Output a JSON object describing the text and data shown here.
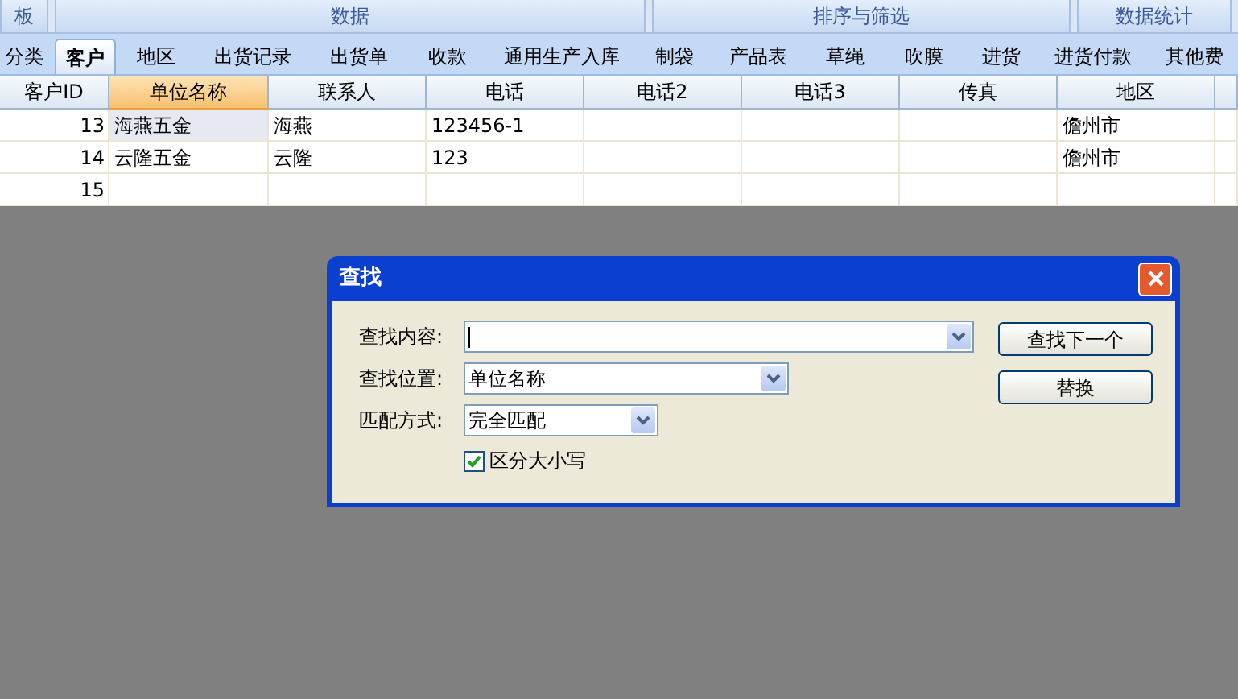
{
  "ribbon_groups": [
    {
      "label": "板"
    },
    {
      "label": "数据"
    },
    {
      "label": "排序与筛选"
    },
    {
      "label": "数据统计"
    }
  ],
  "tabs": [
    {
      "label": "分类",
      "selected": false
    },
    {
      "label": "客户",
      "selected": true
    },
    {
      "label": "地区",
      "selected": false
    },
    {
      "label": "出货记录",
      "selected": false
    },
    {
      "label": "出货单",
      "selected": false
    },
    {
      "label": "收款",
      "selected": false
    },
    {
      "label": "通用生产入库",
      "selected": false
    },
    {
      "label": "制袋",
      "selected": false
    },
    {
      "label": "产品表",
      "selected": false
    },
    {
      "label": "草绳",
      "selected": false
    },
    {
      "label": "吹膜",
      "selected": false
    },
    {
      "label": "进货",
      "selected": false
    },
    {
      "label": "进货付款",
      "selected": false
    },
    {
      "label": "其他费",
      "selected": false
    }
  ],
  "table": {
    "columns": [
      {
        "label": "客户ID",
        "selected": false
      },
      {
        "label": "单位名称",
        "selected": true
      },
      {
        "label": "联系人",
        "selected": false
      },
      {
        "label": "电话",
        "selected": false
      },
      {
        "label": "电话2",
        "selected": false
      },
      {
        "label": "电话3",
        "selected": false
      },
      {
        "label": "传真",
        "selected": false
      },
      {
        "label": "地区",
        "selected": false
      },
      {
        "selected": false
      }
    ],
    "rows": [
      {
        "selected": true,
        "cells": [
          "13",
          "海燕五金",
          "海燕",
          "123456-1",
          null,
          null,
          null,
          "儋州市",
          null
        ]
      },
      {
        "selected": false,
        "cells": [
          "14",
          "云隆五金",
          "云隆",
          "123",
          null,
          null,
          null,
          "儋州市",
          null
        ]
      },
      {
        "selected": false,
        "cells": [
          "15",
          null,
          null,
          null,
          null,
          null,
          null,
          null,
          null
        ]
      }
    ]
  },
  "dialog": {
    "title": "查找",
    "fields": [
      {
        "label": "查找内容:",
        "kind": "combo"
      },
      {
        "label": "查找位置:",
        "value": "单位名称",
        "kind": "combo"
      },
      {
        "label": "匹配方式:",
        "value": "完全匹配",
        "kind": "combo"
      }
    ],
    "checkbox": {
      "label": "区分大小写",
      "checked": true
    },
    "buttons": [
      "查找下一个",
      "替换"
    ]
  }
}
